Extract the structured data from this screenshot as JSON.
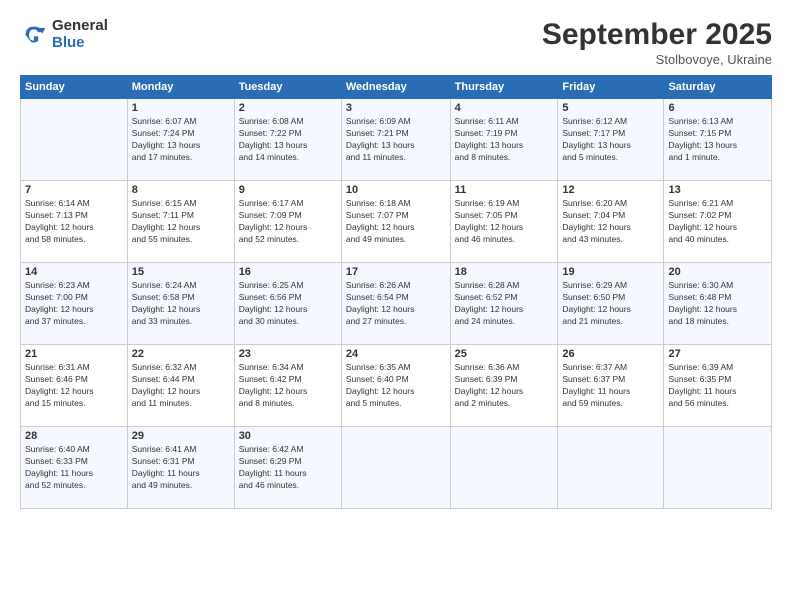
{
  "logo": {
    "general": "General",
    "blue": "Blue"
  },
  "title": "September 2025",
  "location": "Stolbovoye, Ukraine",
  "days_of_week": [
    "Sunday",
    "Monday",
    "Tuesday",
    "Wednesday",
    "Thursday",
    "Friday",
    "Saturday"
  ],
  "weeks": [
    [
      {
        "day": "",
        "info": ""
      },
      {
        "day": "1",
        "info": "Sunrise: 6:07 AM\nSunset: 7:24 PM\nDaylight: 13 hours\nand 17 minutes."
      },
      {
        "day": "2",
        "info": "Sunrise: 6:08 AM\nSunset: 7:22 PM\nDaylight: 13 hours\nand 14 minutes."
      },
      {
        "day": "3",
        "info": "Sunrise: 6:09 AM\nSunset: 7:21 PM\nDaylight: 13 hours\nand 11 minutes."
      },
      {
        "day": "4",
        "info": "Sunrise: 6:11 AM\nSunset: 7:19 PM\nDaylight: 13 hours\nand 8 minutes."
      },
      {
        "day": "5",
        "info": "Sunrise: 6:12 AM\nSunset: 7:17 PM\nDaylight: 13 hours\nand 5 minutes."
      },
      {
        "day": "6",
        "info": "Sunrise: 6:13 AM\nSunset: 7:15 PM\nDaylight: 13 hours\nand 1 minute."
      }
    ],
    [
      {
        "day": "7",
        "info": "Sunrise: 6:14 AM\nSunset: 7:13 PM\nDaylight: 12 hours\nand 58 minutes."
      },
      {
        "day": "8",
        "info": "Sunrise: 6:15 AM\nSunset: 7:11 PM\nDaylight: 12 hours\nand 55 minutes."
      },
      {
        "day": "9",
        "info": "Sunrise: 6:17 AM\nSunset: 7:09 PM\nDaylight: 12 hours\nand 52 minutes."
      },
      {
        "day": "10",
        "info": "Sunrise: 6:18 AM\nSunset: 7:07 PM\nDaylight: 12 hours\nand 49 minutes."
      },
      {
        "day": "11",
        "info": "Sunrise: 6:19 AM\nSunset: 7:05 PM\nDaylight: 12 hours\nand 46 minutes."
      },
      {
        "day": "12",
        "info": "Sunrise: 6:20 AM\nSunset: 7:04 PM\nDaylight: 12 hours\nand 43 minutes."
      },
      {
        "day": "13",
        "info": "Sunrise: 6:21 AM\nSunset: 7:02 PM\nDaylight: 12 hours\nand 40 minutes."
      }
    ],
    [
      {
        "day": "14",
        "info": "Sunrise: 6:23 AM\nSunset: 7:00 PM\nDaylight: 12 hours\nand 37 minutes."
      },
      {
        "day": "15",
        "info": "Sunrise: 6:24 AM\nSunset: 6:58 PM\nDaylight: 12 hours\nand 33 minutes."
      },
      {
        "day": "16",
        "info": "Sunrise: 6:25 AM\nSunset: 6:56 PM\nDaylight: 12 hours\nand 30 minutes."
      },
      {
        "day": "17",
        "info": "Sunrise: 6:26 AM\nSunset: 6:54 PM\nDaylight: 12 hours\nand 27 minutes."
      },
      {
        "day": "18",
        "info": "Sunrise: 6:28 AM\nSunset: 6:52 PM\nDaylight: 12 hours\nand 24 minutes."
      },
      {
        "day": "19",
        "info": "Sunrise: 6:29 AM\nSunset: 6:50 PM\nDaylight: 12 hours\nand 21 minutes."
      },
      {
        "day": "20",
        "info": "Sunrise: 6:30 AM\nSunset: 6:48 PM\nDaylight: 12 hours\nand 18 minutes."
      }
    ],
    [
      {
        "day": "21",
        "info": "Sunrise: 6:31 AM\nSunset: 6:46 PM\nDaylight: 12 hours\nand 15 minutes."
      },
      {
        "day": "22",
        "info": "Sunrise: 6:32 AM\nSunset: 6:44 PM\nDaylight: 12 hours\nand 11 minutes."
      },
      {
        "day": "23",
        "info": "Sunrise: 6:34 AM\nSunset: 6:42 PM\nDaylight: 12 hours\nand 8 minutes."
      },
      {
        "day": "24",
        "info": "Sunrise: 6:35 AM\nSunset: 6:40 PM\nDaylight: 12 hours\nand 5 minutes."
      },
      {
        "day": "25",
        "info": "Sunrise: 6:36 AM\nSunset: 6:39 PM\nDaylight: 12 hours\nand 2 minutes."
      },
      {
        "day": "26",
        "info": "Sunrise: 6:37 AM\nSunset: 6:37 PM\nDaylight: 11 hours\nand 59 minutes."
      },
      {
        "day": "27",
        "info": "Sunrise: 6:39 AM\nSunset: 6:35 PM\nDaylight: 11 hours\nand 56 minutes."
      }
    ],
    [
      {
        "day": "28",
        "info": "Sunrise: 6:40 AM\nSunset: 6:33 PM\nDaylight: 11 hours\nand 52 minutes."
      },
      {
        "day": "29",
        "info": "Sunrise: 6:41 AM\nSunset: 6:31 PM\nDaylight: 11 hours\nand 49 minutes."
      },
      {
        "day": "30",
        "info": "Sunrise: 6:42 AM\nSunset: 6:29 PM\nDaylight: 11 hours\nand 46 minutes."
      },
      {
        "day": "",
        "info": ""
      },
      {
        "day": "",
        "info": ""
      },
      {
        "day": "",
        "info": ""
      },
      {
        "day": "",
        "info": ""
      }
    ]
  ]
}
